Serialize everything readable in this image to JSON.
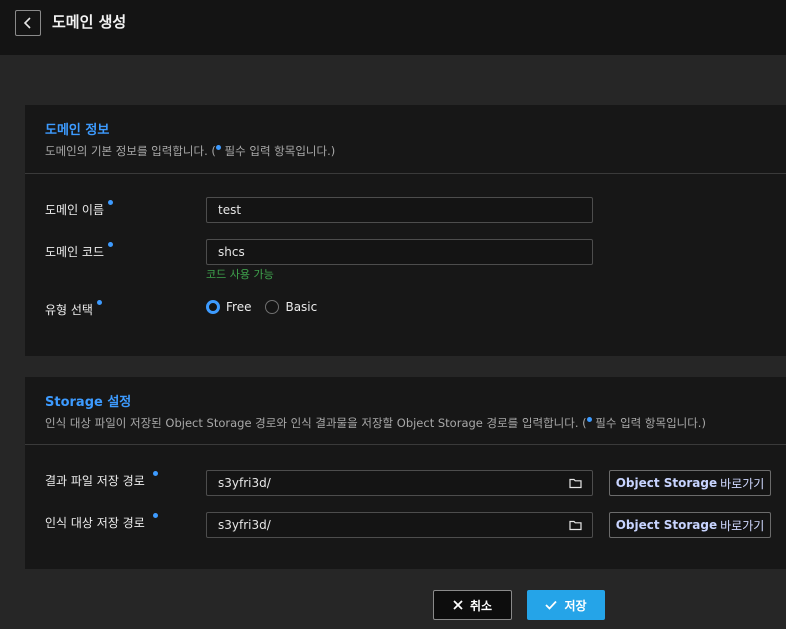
{
  "header": {
    "title": "도메인 생성"
  },
  "domain_section": {
    "title": "도메인 정보",
    "desc_prefix": "도메인의 기본 정보를 입력합니다. (",
    "desc_suffix": " 필수 입력 항목입니다.)",
    "name_label": "도메인 이름",
    "name_value": "test",
    "code_label": "도메인 코드",
    "code_value": "shcs",
    "code_hint": "코드 사용 가능",
    "type_label": "유형 선택",
    "type_options": [
      "Free",
      "Basic"
    ],
    "type_selected": "Free"
  },
  "storage_section": {
    "title": "Storage 설정",
    "desc_prefix": "인식 대상 파일이 저장된 Object Storage 경로와 인식 결과물을 저장할 Object Storage 경로를 입력합니다. (",
    "desc_suffix": " 필수 입력 항목입니다.)",
    "result_label": "결과 파일 저장 경로",
    "result_value": "s3yfri3d/",
    "target_label": "인식 대상 저장 경로",
    "target_value": "s3yfri3d/",
    "browse_strong": "Object Storage",
    "browse_rest": "바로가기"
  },
  "footer": {
    "cancel": "취소",
    "save": "저장"
  },
  "colors": {
    "accent": "#3d9bff",
    "save_bg": "#25a4e8",
    "hint": "#3fa34d"
  },
  "icons": [
    "chevron-left-icon",
    "folder-icon",
    "close-icon",
    "check-icon"
  ]
}
